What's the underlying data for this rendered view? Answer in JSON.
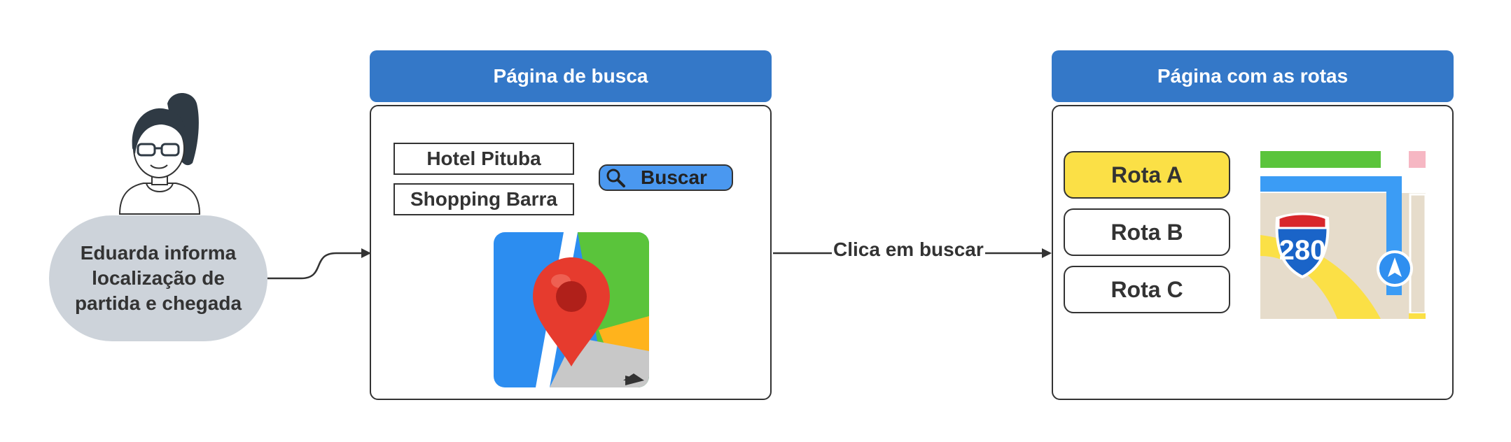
{
  "persona": {
    "description": "Eduarda informa\nlocalização de\npartida e chegada"
  },
  "search_page": {
    "title": "Página de busca",
    "origin_value": "Hotel Pituba",
    "destination_value": "Shopping Barra",
    "search_button_label": "Buscar"
  },
  "routes_page": {
    "title": "Página com as rotas",
    "routes": [
      {
        "label": "Rota A",
        "selected": true
      },
      {
        "label": "Rota B",
        "selected": false
      },
      {
        "label": "Rota C",
        "selected": false
      }
    ],
    "map_shield_number": "280"
  },
  "edges": {
    "search_to_routes_label": "Clica em buscar"
  },
  "colors": {
    "header_blue": "#3478c8",
    "persona_gray": "#cdd3da",
    "selected_route_yellow": "#fbe046",
    "search_button_blue": "#4a98f0",
    "stroke": "#333333"
  }
}
